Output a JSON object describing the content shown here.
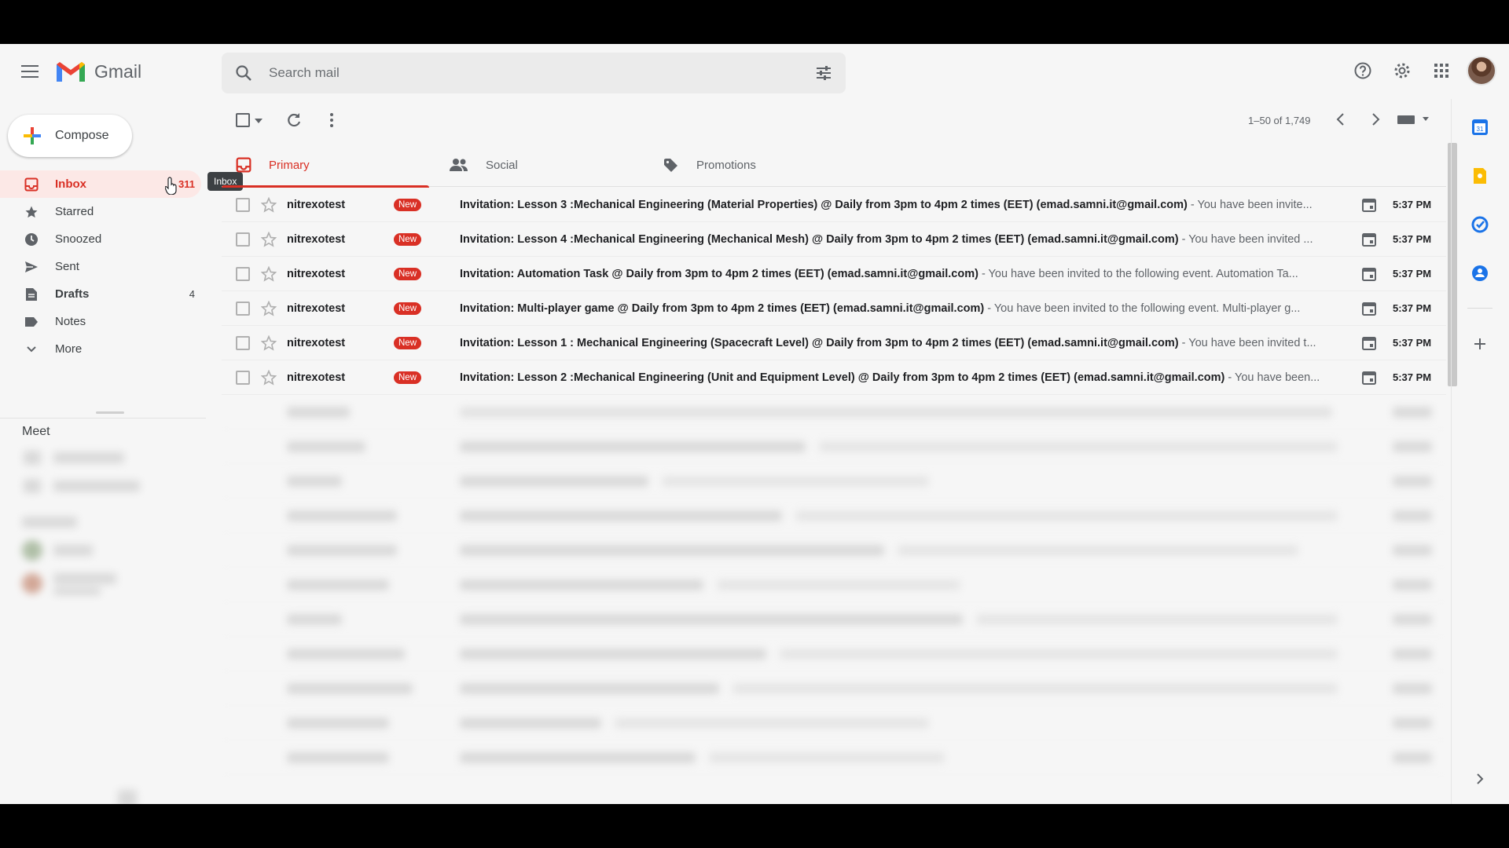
{
  "app": {
    "name": "Gmail"
  },
  "search": {
    "placeholder": "Search mail"
  },
  "compose": {
    "label": "Compose"
  },
  "nav": {
    "items": [
      {
        "label": "Inbox",
        "count": "311",
        "icon": "inbox-icon",
        "active": true
      },
      {
        "label": "Starred",
        "count": "",
        "icon": "star-icon"
      },
      {
        "label": "Snoozed",
        "count": "",
        "icon": "clock-icon"
      },
      {
        "label": "Sent",
        "count": "",
        "icon": "send-icon"
      },
      {
        "label": "Drafts",
        "count": "4",
        "icon": "draft-icon"
      },
      {
        "label": "Notes",
        "count": "",
        "icon": "label-icon"
      },
      {
        "label": "More",
        "count": "",
        "icon": "chevron-down-icon"
      }
    ],
    "tooltip": "Inbox"
  },
  "meet": {
    "title": "Meet"
  },
  "toolbar": {
    "pager": "1–50 of 1,749"
  },
  "tabs": [
    {
      "label": "Primary",
      "icon": "inbox-icon"
    },
    {
      "label": "Social",
      "icon": "people-icon"
    },
    {
      "label": "Promotions",
      "icon": "tag-icon"
    }
  ],
  "emails": [
    {
      "sender": "nitrexotest",
      "badge": "New",
      "subject": "Invitation: Lesson 3 :Mechanical Engineering (Material Properties) @ Daily from 3pm to 4pm 2 times (EET) (emad.samni.it@gmail.com)",
      "snippet": " - You have been invite...",
      "time": "5:37 PM"
    },
    {
      "sender": "nitrexotest",
      "badge": "New",
      "subject": "Invitation: Lesson 4 :Mechanical Engineering (Mechanical Mesh) @ Daily from 3pm to 4pm 2 times (EET) (emad.samni.it@gmail.com)",
      "snippet": " - You have been invited ...",
      "time": "5:37 PM"
    },
    {
      "sender": "nitrexotest",
      "badge": "New",
      "subject": "Invitation: Automation Task @ Daily from 3pm to 4pm 2 times (EET) (emad.samni.it@gmail.com)",
      "snippet": " - You have been invited to the following event. Automation Ta...",
      "time": "5:37 PM"
    },
    {
      "sender": "nitrexotest",
      "badge": "New",
      "subject": "Invitation: Multi-player game @ Daily from 3pm to 4pm 2 times (EET) (emad.samni.it@gmail.com)",
      "snippet": " - You have been invited to the following event. Multi-player g...",
      "time": "5:37 PM"
    },
    {
      "sender": "nitrexotest",
      "badge": "New",
      "subject": "Invitation: Lesson 1 : Mechanical Engineering (Spacecraft Level) @ Daily from 3pm to 4pm 2 times (EET) (emad.samni.it@gmail.com)",
      "snippet": " - You have been invited t...",
      "time": "5:37 PM"
    },
    {
      "sender": "nitrexotest",
      "badge": "New",
      "subject": "Invitation: Lesson 2 :Mechanical Engineering (Unit and Equipment Level) @ Daily from 3pm to 4pm 2 times (EET) (emad.samni.it@gmail.com)",
      "snippet": " - You have been...",
      "time": "5:37 PM"
    }
  ],
  "colors": {
    "accent": "#d93025",
    "background": "#f6f6f6"
  }
}
